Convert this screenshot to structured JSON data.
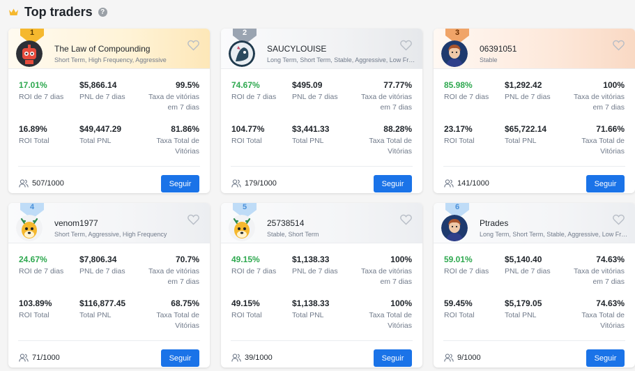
{
  "header": {
    "title": "Top traders",
    "crown_icon": "crown-icon",
    "help_icon": "help-icon"
  },
  "colors": {
    "accent": "#1a73e8",
    "positive": "#2ea84f",
    "gold": "#f5b82e",
    "silver": "#9aa4b1",
    "bronze": "#f0a468"
  },
  "labels": {
    "roi7": "ROI de 7 dias",
    "pnl7": "PNL de 7 dias",
    "win7": "Taxa de vitórias em 7 dias",
    "roiTotal": "ROI Total",
    "pnlTotal": "Total PNL",
    "winTotal": "Taxa Total de Vitórias",
    "follow": "Seguir"
  },
  "traders": [
    {
      "rank": "1",
      "name": "The Law of Compounding",
      "tags": "Short Term, High Frequency, Aggressive",
      "roi7": "17.01%",
      "pnl7": "$5,866.14",
      "win7": "99.5%",
      "roiTotal": "16.89%",
      "pnlTotal": "$49,447.29",
      "winTotal": "81.86%",
      "copiers": "507/1000"
    },
    {
      "rank": "2",
      "name": "SAUCYLOUISE",
      "tags": "Long Term, Short Term, Stable, Aggressive, Low Frequency",
      "roi7": "74.67%",
      "pnl7": "$495.09",
      "win7": "77.77%",
      "roiTotal": "104.77%",
      "pnlTotal": "$3,441.33",
      "winTotal": "88.28%",
      "copiers": "179/1000"
    },
    {
      "rank": "3",
      "name": "06391051",
      "tags": "Stable",
      "roi7": "85.98%",
      "pnl7": "$1,292.42",
      "win7": "100%",
      "roiTotal": "23.17%",
      "pnlTotal": "$65,722.14",
      "winTotal": "71.66%",
      "copiers": "141/1000"
    },
    {
      "rank": "4",
      "name": "venom1977",
      "tags": "Short Term, Aggressive, High Frequency",
      "roi7": "24.67%",
      "pnl7": "$7,806.34",
      "win7": "70.7%",
      "roiTotal": "103.89%",
      "pnlTotal": "$116,877.45",
      "winTotal": "68.75%",
      "copiers": "71/1000"
    },
    {
      "rank": "5",
      "name": "25738514",
      "tags": "Stable, Short Term",
      "roi7": "49.15%",
      "pnl7": "$1,138.33",
      "win7": "100%",
      "roiTotal": "49.15%",
      "pnlTotal": "$1,138.33",
      "winTotal": "100%",
      "copiers": "39/1000"
    },
    {
      "rank": "6",
      "name": "Ptrades",
      "tags": "Long Term, Short Term, Stable, Aggressive, Low Frequency",
      "roi7": "59.01%",
      "pnl7": "$5,140.40",
      "win7": "74.63%",
      "roiTotal": "59.45%",
      "pnlTotal": "$5,179.05",
      "winTotal": "74.63%",
      "copiers": "9/1000"
    }
  ]
}
